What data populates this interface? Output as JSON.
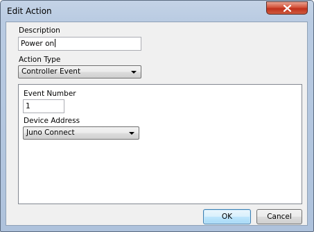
{
  "window": {
    "title": "Edit Action"
  },
  "form": {
    "description_label": "Description",
    "description_value": "Power on",
    "action_type_label": "Action Type",
    "action_type_value": "Controller Event",
    "event_number_label": "Event Number",
    "event_number_value": "1",
    "device_address_label": "Device Address",
    "device_address_value": "Juno Connect"
  },
  "buttons": {
    "ok_label": "OK",
    "cancel_label": "Cancel"
  },
  "colors": {
    "close_button": "#c0311c",
    "default_button_border": "#3c7fb1",
    "dialog_background": "#f0f0f0"
  }
}
